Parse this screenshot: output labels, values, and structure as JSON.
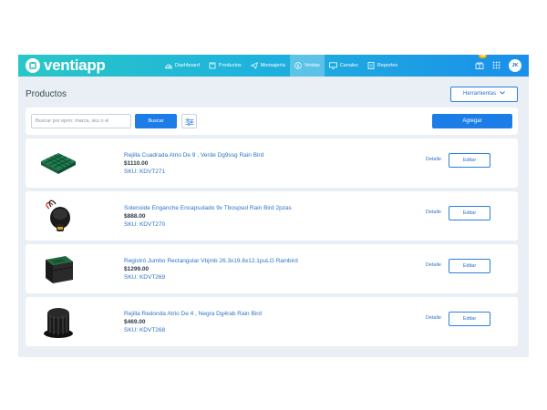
{
  "app": {
    "brand": "ventiapp",
    "accent_color": "#1d7de8",
    "topbar_gradient": [
      "#29c7c7",
      "#1a8fea"
    ]
  },
  "nav": {
    "items": [
      {
        "label": "Dashboard",
        "icon": "dashboard-icon",
        "active": false
      },
      {
        "label": "Productos",
        "icon": "box-icon",
        "active": false
      },
      {
        "label": "Mensajería",
        "icon": "paper-plane-icon",
        "active": false
      },
      {
        "label": "Ventas",
        "icon": "dollar-icon",
        "active": true
      },
      {
        "label": "Canales",
        "icon": "monitor-icon",
        "active": false
      },
      {
        "label": "Reportes",
        "icon": "report-icon",
        "active": false
      }
    ],
    "notification_count": "35",
    "user_initials": "JK"
  },
  "page": {
    "title": "Productos",
    "tools_label": "Herramientas"
  },
  "search": {
    "placeholder": "Buscar por ejem: marca, sku o el",
    "button_label": "Buscar",
    "add_label": "Agregar"
  },
  "products": [
    {
      "name": "Rejilla Cuadrada Atrio De 9 , Verde Dg9ssg Rain Bird",
      "price": "$1110.00",
      "sku": "SKU: KDVT271",
      "detail_label": "Detalle",
      "edit_label": "Editar",
      "image": "green-square-grate"
    },
    {
      "name": "Solenoide Enganche Encapsulado 9v Tbospsol Rain Bird 2pzas",
      "price": "$888.00",
      "sku": "SKU: KDVT270",
      "detail_label": "Detalle",
      "edit_label": "Editar",
      "image": "solenoid"
    },
    {
      "name": "Registró Jumbo Rectangular Vbjmb 26.3x19.8x12.1puLG Rainbird",
      "price": "$1299.00",
      "sku": "SKU: KDVT269",
      "detail_label": "Detalle",
      "edit_label": "Editar",
      "image": "valve-box"
    },
    {
      "name": "Rejilla Redonda Atrio De 4 , Negra Dg4rab Rain Bird",
      "price": "$469.00",
      "sku": "SKU: KDVT268",
      "detail_label": "Detalle",
      "edit_label": "Editar",
      "image": "black-round-grate"
    }
  ]
}
